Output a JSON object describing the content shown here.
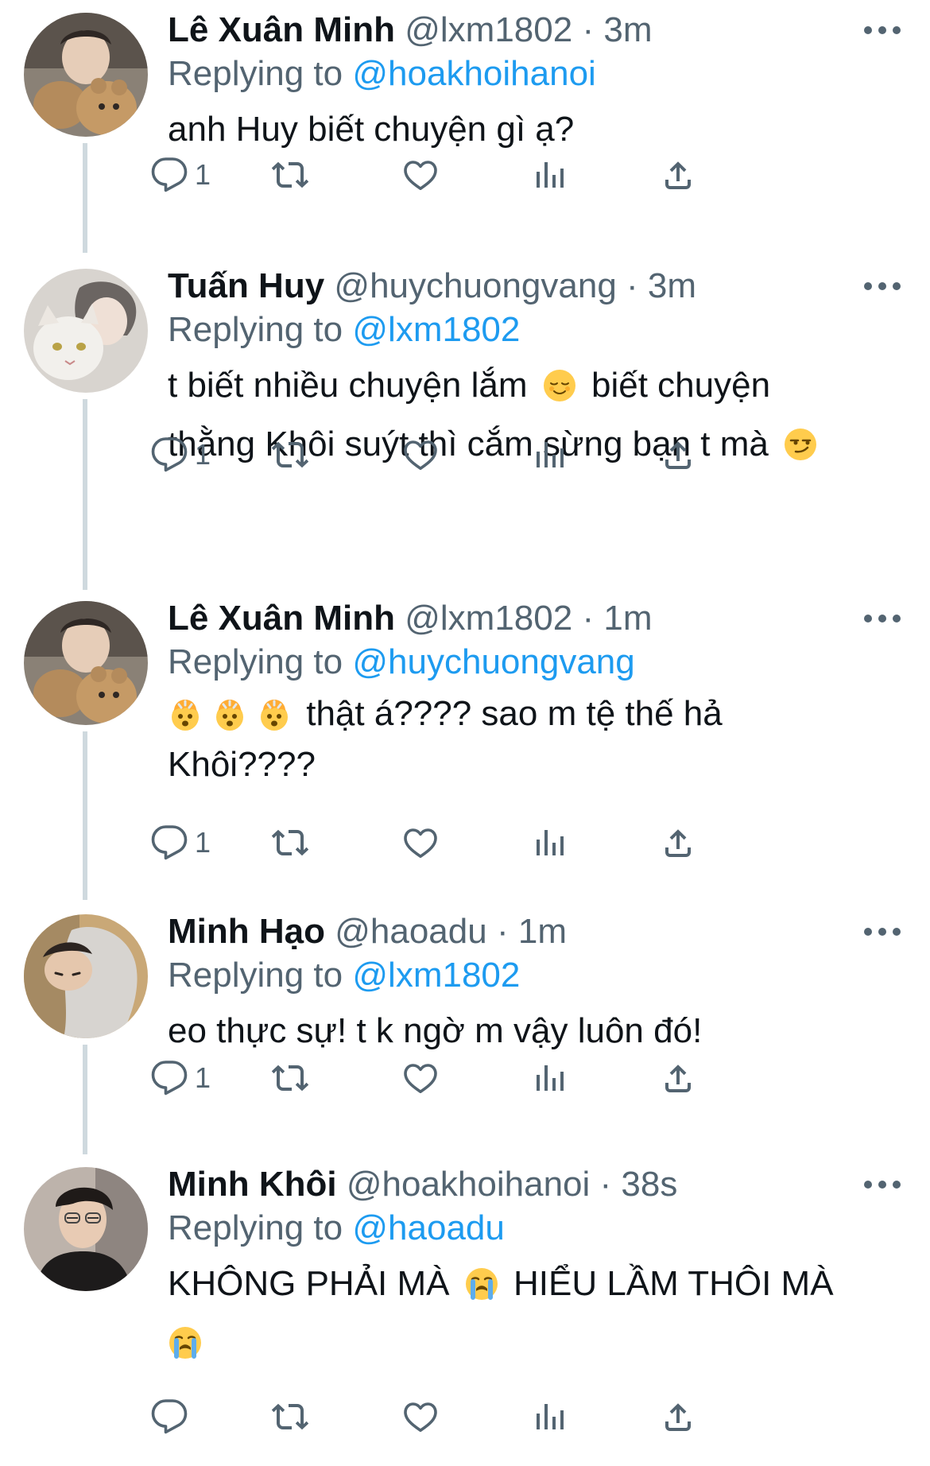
{
  "colors": {
    "text": "#0f1419",
    "secondary": "#536471",
    "link": "#1d9bf0",
    "thread_line": "#cfd9de"
  },
  "tweets": [
    {
      "name": "Lê Xuân Minh",
      "handle": "@lxm1802",
      "time": "3m",
      "replying_prefix": "Replying to",
      "replying_to": "@hoakhoihanoi",
      "text_lines": [
        "anh Huy biết chuyện gì ạ?"
      ],
      "reply_count": "1",
      "avatar_icon": "avatar-teddy-bear"
    },
    {
      "name": "Tuấn Huy",
      "handle": "@huychuongvang",
      "time": "3m",
      "replying_prefix": "Replying to",
      "replying_to": "@lxm1802",
      "text_parts": {
        "a": "t biết nhiều chuyện lắm",
        "b": "biết chuyện",
        "c": "thằng Khôi suýt thì cắm sừng bạn t mà"
      },
      "reply_count": "1",
      "avatar_icon": "avatar-cat"
    },
    {
      "name": "Lê Xuân Minh",
      "handle": "@lxm1802",
      "time": "1m",
      "replying_prefix": "Replying to",
      "replying_to": "@huychuongvang",
      "text_parts": {
        "a": "thật á???? sao m tệ thế hả",
        "b": "Khôi????"
      },
      "reply_count": "1",
      "avatar_icon": "avatar-teddy-bear"
    },
    {
      "name": "Minh Hạo",
      "handle": "@haoadu",
      "time": "1m",
      "replying_prefix": "Replying to",
      "replying_to": "@lxm1802",
      "text_lines": [
        "eo thực sự! t k ngờ m vậy luôn đó!"
      ],
      "reply_count": "1",
      "avatar_icon": "avatar-hood"
    },
    {
      "name": "Minh Khôi",
      "handle": "@hoakhoihanoi",
      "time": "38s",
      "replying_prefix": "Replying to",
      "replying_to": "@haoadu",
      "text_parts": {
        "a": "KHÔNG PHẢI MÀ",
        "b": "HIỂU LẦM THÔI MÀ"
      },
      "reply_count": "",
      "avatar_icon": "avatar-portrait"
    }
  ],
  "separator": "·"
}
